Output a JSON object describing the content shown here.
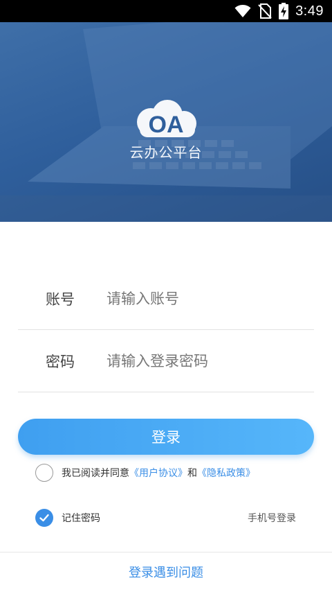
{
  "status_bar": {
    "time": "3:49",
    "icons": [
      "wifi-icon",
      "no-sim-icon",
      "battery-charging-icon"
    ]
  },
  "hero": {
    "logo_text": "OA",
    "app_name": "云办公平台"
  },
  "form": {
    "account_label": "账号",
    "account_placeholder": "请输入账号",
    "account_value": "",
    "password_label": "密码",
    "password_placeholder": "请输入登录密码",
    "password_value": ""
  },
  "login_button": "登录",
  "agreement": {
    "checked": false,
    "prefix": "我已阅读并同意",
    "user_agreement": "《用户协议》",
    "conjunction": "和",
    "privacy_policy": "《隐私政策》"
  },
  "remember": {
    "checked": true,
    "label": "记住密码"
  },
  "phone_login": "手机号登录",
  "trouble_link": "登录遇到问题",
  "colors": {
    "hero_bg": "#2f5f9c",
    "accent": "#3a8ee6",
    "button_start": "#3f9ff0",
    "button_end": "#56b6fa"
  }
}
